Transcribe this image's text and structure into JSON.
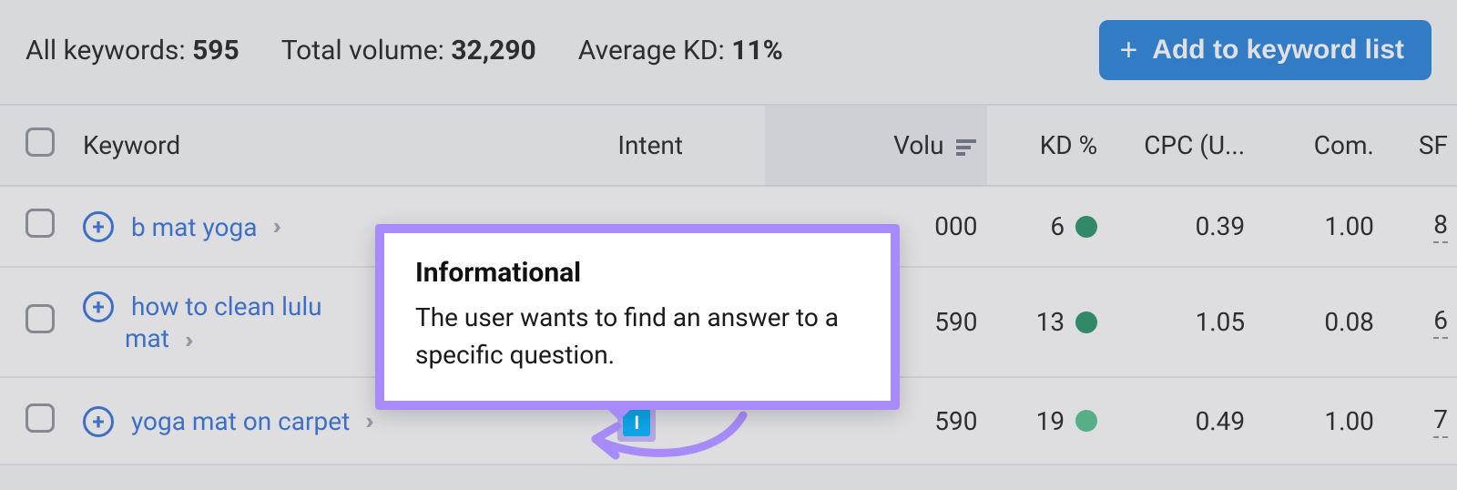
{
  "stats": {
    "all_keywords_label": "All keywords: ",
    "all_keywords_value": "595",
    "total_volume_label": "Total volume: ",
    "total_volume_value": "32,290",
    "avg_kd_label": "Average KD: ",
    "avg_kd_value": "11%"
  },
  "button": {
    "add_to_list": "Add to keyword list"
  },
  "columns": {
    "keyword": "Keyword",
    "intent": "Intent",
    "volume": "Volu",
    "kd": "KD %",
    "cpc": "CPC (U...",
    "com": "Com.",
    "sf": "SF"
  },
  "rows": [
    {
      "keyword": "b mat yoga",
      "intent": "",
      "volume": "000",
      "kd": "6",
      "kd_color": "green",
      "cpc": "0.39",
      "com": "1.00",
      "sf": "8"
    },
    {
      "keyword": "how to clean lululemon yoga mat",
      "keyword_display_line1": "how to clean lulu",
      "keyword_display_line2": "mat",
      "intent": "",
      "volume": "590",
      "kd": "13",
      "kd_color": "green",
      "cpc": "1.05",
      "com": "0.08",
      "sf": "6"
    },
    {
      "keyword": "yoga mat on carpet",
      "intent": "I",
      "volume": "590",
      "kd": "19",
      "kd_color": "lightgreen",
      "cpc": "0.49",
      "com": "1.00",
      "sf": "7"
    }
  ],
  "tooltip": {
    "title": "Informational",
    "body": "The user wants to find an answer to a specific question."
  }
}
